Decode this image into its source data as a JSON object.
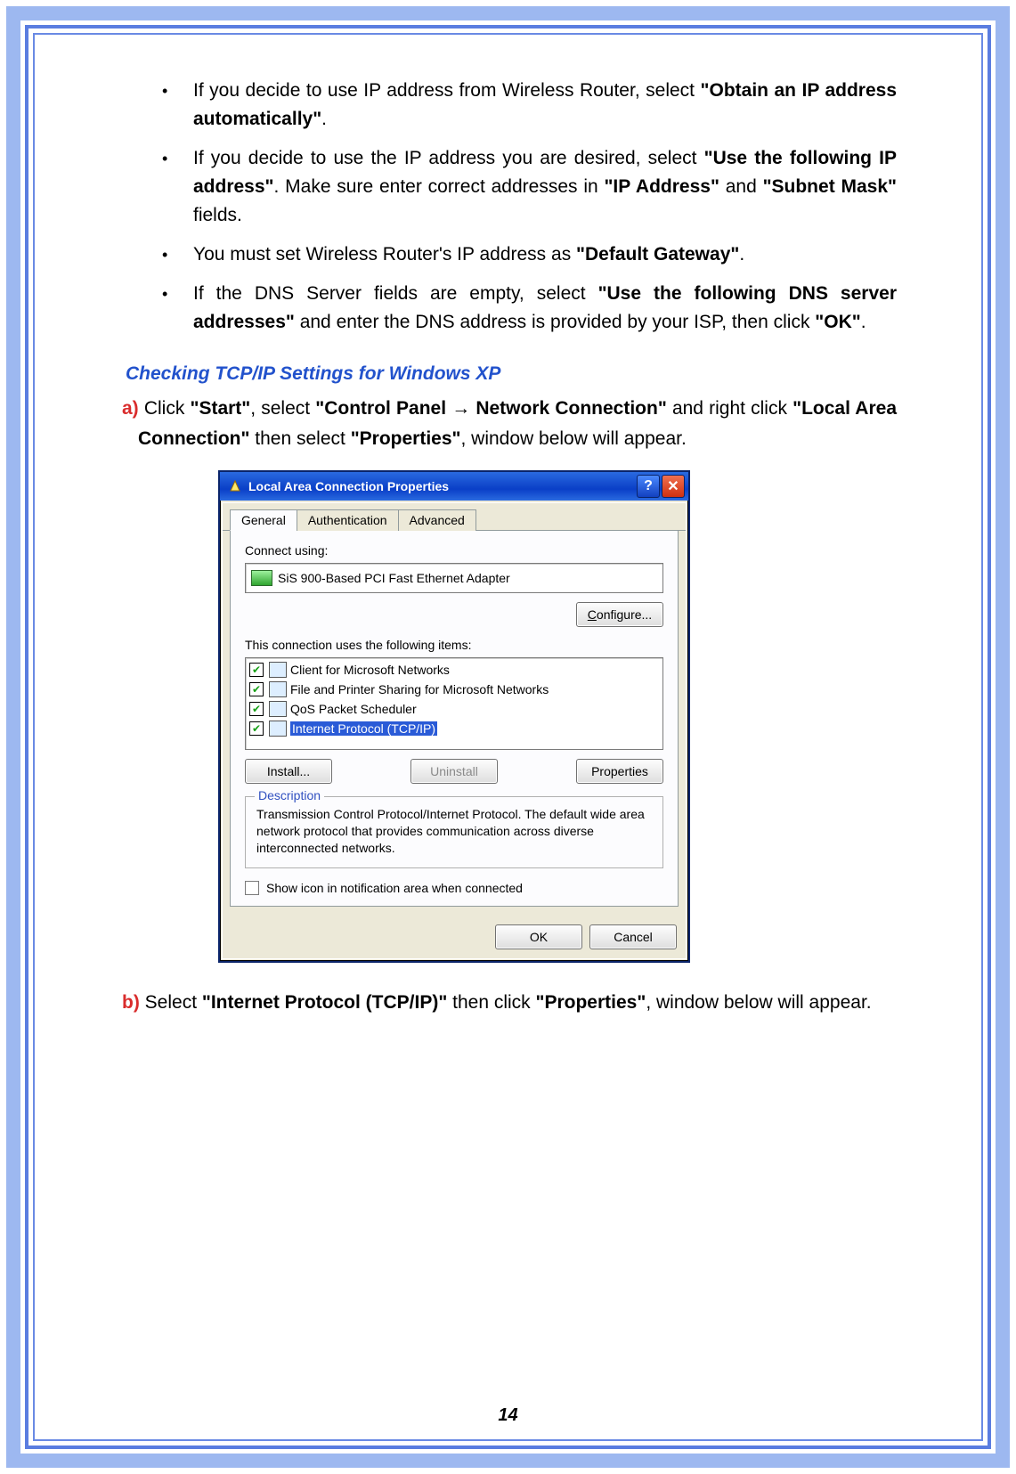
{
  "page_number": "14",
  "bullets": [
    {
      "plain_a": "If you decide to use IP address from Wireless Router, select ",
      "bold_a": "\"Obtain an IP address automatically\"",
      "plain_b": "."
    },
    {
      "plain_a": "If you decide to use the IP address you are desired, select ",
      "bold_a": "\"Use the following IP address\"",
      "plain_b": ". Make sure enter correct addresses in ",
      "bold_b": "\"IP Address\"",
      "plain_c": " and ",
      "bold_c": "\"Subnet Mask\"",
      "plain_d": " fields."
    },
    {
      "plain_a": "You must set Wireless Router's IP address as ",
      "bold_a": "\"Default Gateway\"",
      "plain_b": "."
    },
    {
      "plain_a": "If the DNS Server fields are empty, select ",
      "bold_a": "\"Use the following DNS server addresses\"",
      "plain_b": " and enter the DNS address is provided by your ISP, then click ",
      "bold_b": "\"OK\"",
      "plain_c": "."
    }
  ],
  "heading_checking": "Checking TCP/IP Settings for Windows XP",
  "step_a": {
    "letter": "a)",
    "p1": " Click ",
    "b1": "\"Start\"",
    "p2": ", select ",
    "b2": "\"Control Panel ",
    "arrow": "→",
    "b2b": " Network Connection\"",
    "p3": " and right click ",
    "b3": "\"Local Area Connection\"",
    "p4": " then select ",
    "b4": "\"Properties\"",
    "p5": ", window below will appear."
  },
  "step_b": {
    "letter": "b)",
    "p1": " Select ",
    "b1": "\"Internet Protocol (TCP/IP)\"",
    "p2": " then click ",
    "b2": "\"Properties\"",
    "p3": ", window below will appear."
  },
  "dialog": {
    "title": "Local Area Connection Properties",
    "tabs": [
      "General",
      "Authentication",
      "Advanced"
    ],
    "connect_using_label": "Connect using:",
    "adapter": "SiS 900-Based PCI Fast Ethernet Adapter",
    "configure_label": "Configure...",
    "items_label": "This connection uses the following items:",
    "items": [
      "Client for Microsoft Networks",
      "File and Printer Sharing for Microsoft Networks",
      "QoS Packet Scheduler",
      "Internet Protocol (TCP/IP)"
    ],
    "install_label": "Install...",
    "uninstall_label": "Uninstall",
    "properties_label": "Properties",
    "desc_legend": "Description",
    "desc_text": "Transmission Control Protocol/Internet Protocol. The default wide area network protocol that provides communication across diverse interconnected networks.",
    "show_icon_label": "Show icon in notification area when connected",
    "ok_label": "OK",
    "cancel_label": "Cancel"
  }
}
